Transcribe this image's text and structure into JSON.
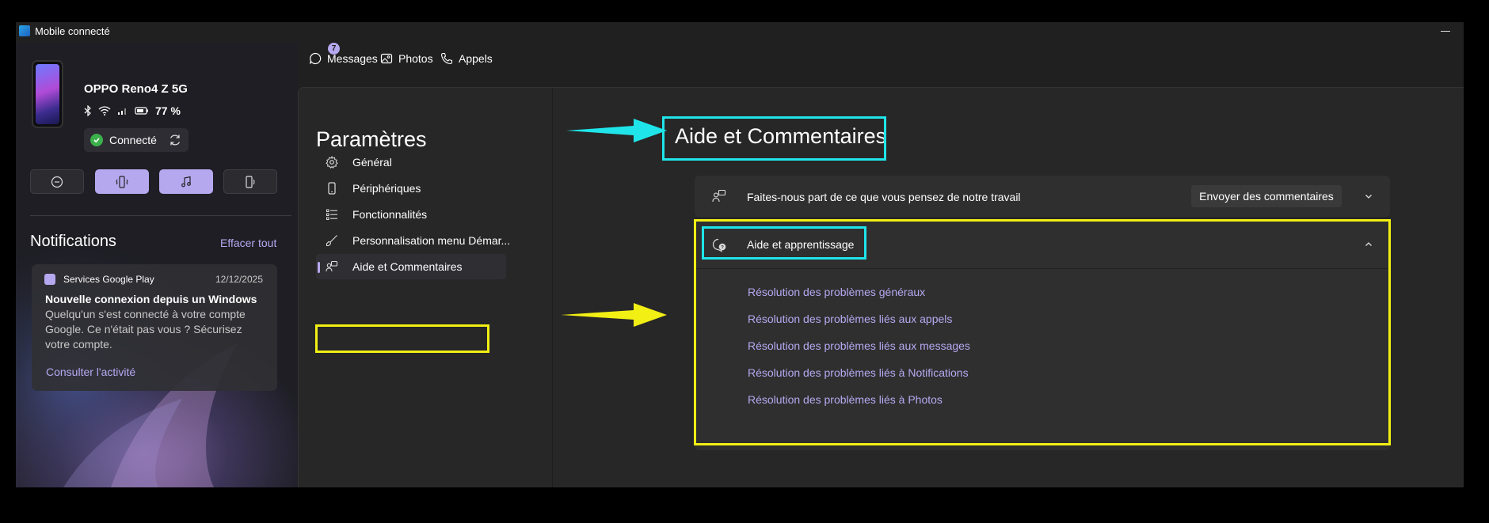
{
  "window": {
    "title": "Mobile connecté"
  },
  "device": {
    "name": "OPPO Reno4 Z 5G",
    "battery": "77 %",
    "status": "Connecté"
  },
  "quick_actions": [
    {
      "icon": "do-not-disturb-icon",
      "active": false
    },
    {
      "icon": "vibrate-icon",
      "active": true
    },
    {
      "icon": "music-icon",
      "active": true
    },
    {
      "icon": "audio-device-icon",
      "active": false
    }
  ],
  "notifications": {
    "title": "Notifications",
    "clear_all": "Effacer tout",
    "card": {
      "app": "Services Google Play",
      "date": "12/12/2025",
      "title": "Nouvelle connexion depuis un Windows",
      "body": "Quelqu'un s'est connecté à votre compte Google. Ce n'était pas vous ? Sécurisez votre compte.",
      "action": "Consulter l'activité"
    }
  },
  "tabs": [
    {
      "label": "Messages",
      "badge": "7"
    },
    {
      "label": "Photos"
    },
    {
      "label": "Appels"
    }
  ],
  "settings": {
    "title": "Paramètres",
    "nav": [
      {
        "label": "Général",
        "icon": "gear-icon"
      },
      {
        "label": "Périphériques",
        "icon": "phone-icon"
      },
      {
        "label": "Fonctionnalités",
        "icon": "list-icon"
      },
      {
        "label": "Personnalisation menu Démar...",
        "icon": "brush-icon"
      },
      {
        "label": "Aide et Commentaires",
        "icon": "feedback-icon",
        "selected": true
      }
    ]
  },
  "content": {
    "title": "Aide et Commentaires",
    "feedback": {
      "label": "Faites-nous part de ce que vous pensez de notre travail",
      "button": "Envoyer des commentaires"
    },
    "help": {
      "label": "Aide et apprentissage",
      "links": [
        "Résolution des problèmes généraux",
        "Résolution des problèmes liés aux appels",
        "Résolution des problèmes liés aux messages",
        "Résolution des problèmes liés à Notifications",
        "Résolution des problèmes liés à Photos"
      ]
    }
  },
  "colors": {
    "accent": "#b6a8ee",
    "highlight_yellow": "#f2ef14",
    "highlight_cyan": "#1fe5ea",
    "link": "#b7a9f2"
  }
}
